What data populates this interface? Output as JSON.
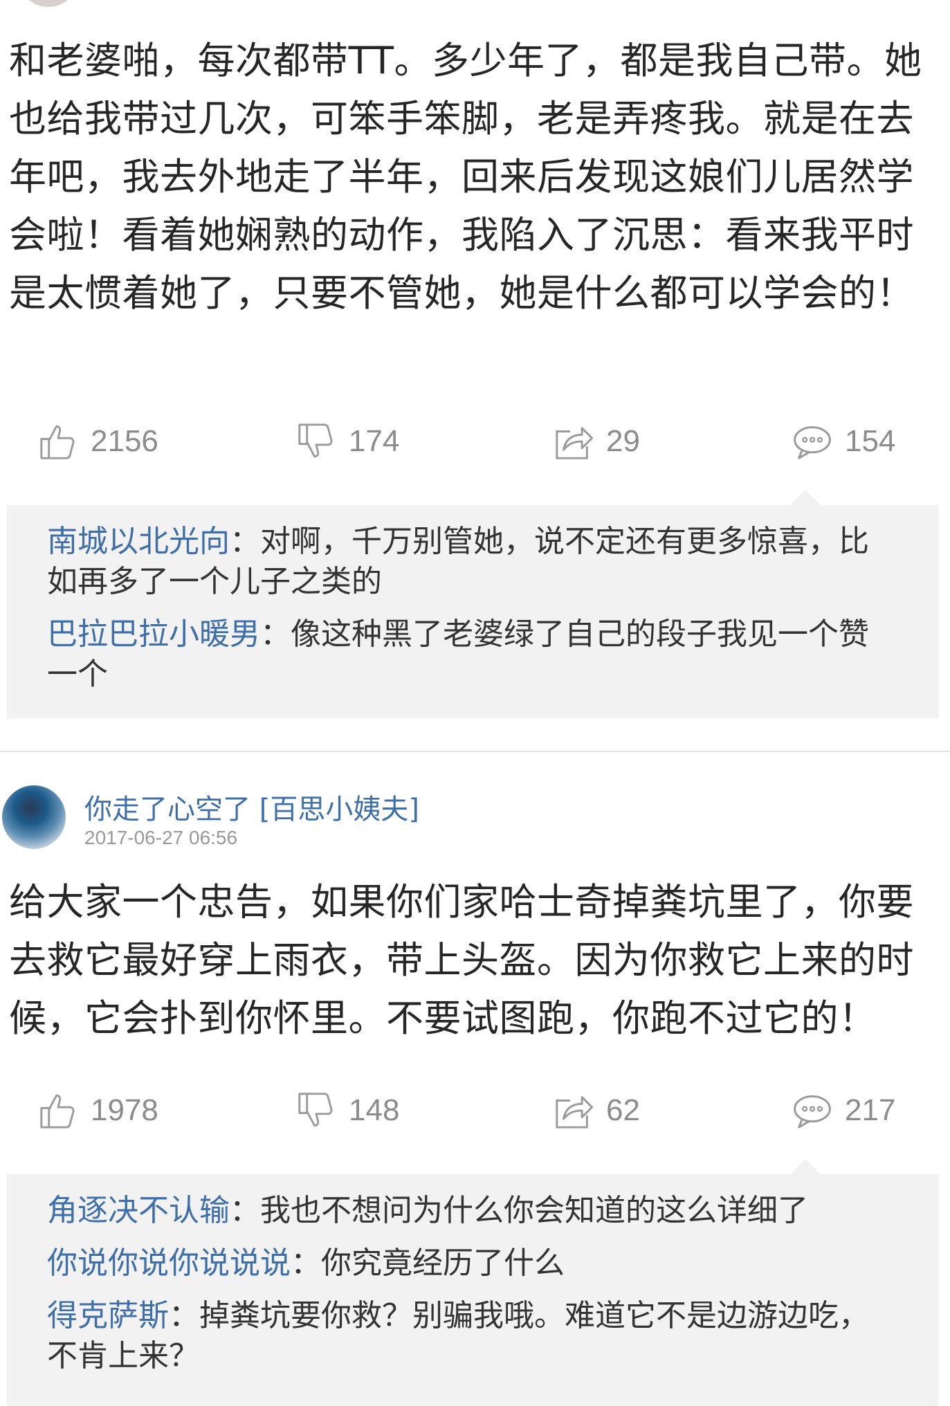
{
  "posts": [
    {
      "body": "和老婆啪，每次都带TT。多少年了，都是我自己带。她也给我带过几次，可笨手笨脚，老是弄疼我。就是在去年吧，我去外地走了半年，回来后发现这娘们儿居然学会啦！看着她娴熟的动作，我陷入了沉思：看来我平时是太惯着她了，只要不管她，她是什么都可以学会的！",
      "likes": "2156",
      "dislikes": "174",
      "shares": "29",
      "comments": "154",
      "replies": [
        {
          "author": "南城以北光向",
          "sep": "：",
          "text": "对啊，千万别管她，说不定还有更多惊喜，比如再多了一个儿子之类的"
        },
        {
          "author": "巴拉巴拉小暖男",
          "sep": "：",
          "text": "像这种黑了老婆绿了自己的段子我见一个赞一个"
        }
      ]
    },
    {
      "author": "你走了心空了 [百思小姨夫]",
      "time": "2017-06-27 06:56",
      "body": "给大家一个忠告，如果你们家哈士奇掉粪坑里了，你要去救它最好穿上雨衣，带上头盔。因为你救它上来的时候，它会扑到你怀里。不要试图跑，你跑不过它的！",
      "likes": "1978",
      "dislikes": "148",
      "shares": "62",
      "comments": "217",
      "replies": [
        {
          "author": "角逐决不认输",
          "sep": "：",
          "text": "我也不想问为什么你会知道的这么详细了"
        },
        {
          "author": "你说你说你说说说",
          "sep": "：",
          "text": "你究竟经历了什么"
        },
        {
          "author": "得克萨斯",
          "sep": "：",
          "text": "掉粪坑要你救？别骗我哦。难道它不是边游边吃，不肯上来？"
        }
      ]
    }
  ],
  "icons": {
    "like": "thumbs-up-icon",
    "dislike": "thumbs-down-icon",
    "share": "share-icon",
    "comment": "comment-bubble-icon"
  },
  "colors": {
    "author_link": "#3e6fa8",
    "action_gray": "#8c8c8c",
    "reply_bg": "#f2f2f2"
  }
}
